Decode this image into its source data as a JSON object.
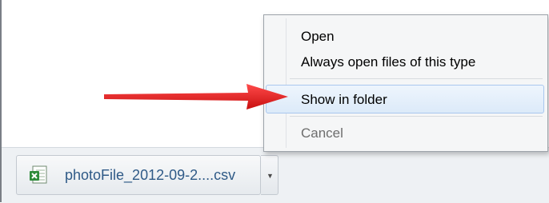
{
  "context_menu": {
    "items": [
      {
        "label": "Open"
      },
      {
        "label": "Always open files of this type"
      },
      {
        "label": "Show in folder"
      },
      {
        "label": "Cancel"
      }
    ]
  },
  "download_bar": {
    "file_name": "photoFile_2012-09-2....csv",
    "file_icon": "excel-csv-icon",
    "dropdown_icon": "dropdown-arrow-icon"
  },
  "annotation": {
    "icon": "pointer-arrow-icon",
    "color": "#e41e1e"
  }
}
